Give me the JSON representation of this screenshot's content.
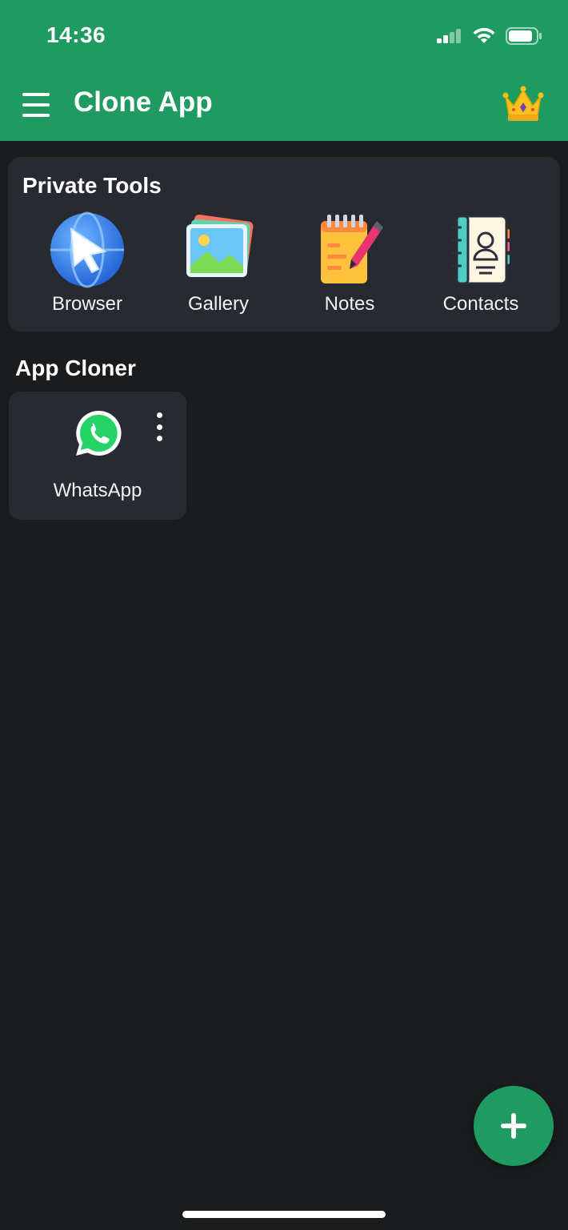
{
  "status_bar": {
    "time": "14:36",
    "icons": [
      "signal-icon",
      "wifi-icon",
      "battery-icon"
    ]
  },
  "header": {
    "title": "Clone App",
    "menu_icon": "hamburger-menu-icon",
    "premium_icon": "crown-icon",
    "color": "#1f9a60"
  },
  "private_tools": {
    "title": "Private Tools",
    "items": [
      {
        "label": "Browser",
        "icon": "browser-icon"
      },
      {
        "label": "Gallery",
        "icon": "gallery-icon"
      },
      {
        "label": "Notes",
        "icon": "notes-icon"
      },
      {
        "label": "Contacts",
        "icon": "contacts-icon"
      }
    ]
  },
  "app_cloner": {
    "title": "App Cloner",
    "apps": [
      {
        "label": "WhatsApp",
        "icon": "whatsapp-icon",
        "menu_icon": "more-options-icon"
      }
    ]
  },
  "fab": {
    "icon": "plus-icon"
  },
  "colors": {
    "accent": "#1f9a60",
    "background": "#1a1c1e",
    "card": "#272a30"
  }
}
